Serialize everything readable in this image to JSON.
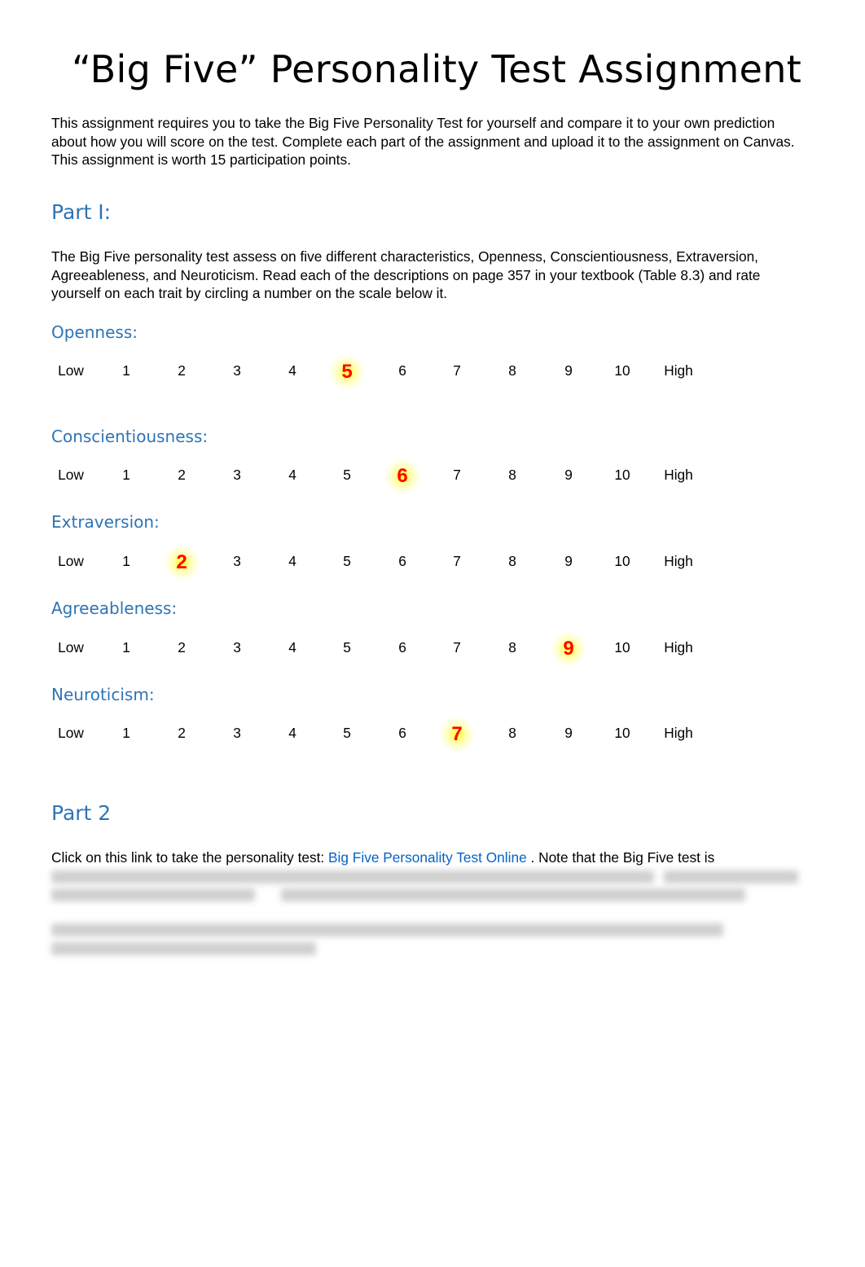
{
  "document": {
    "title": "“Big Five” Personality Test Assignment",
    "intro": "This assignment requires you to take the Big Five Personality Test for yourself and compare it to your own prediction about how you will score on the test.  Complete each part of the assignment and upload it to the assignment on Canvas.  This assignment is worth 15 participation points.",
    "part1": {
      "heading": "Part I:",
      "instructions": "The Big Five personality test assess on five different characteristics, Openness, Conscientiousness, Extraversion, Agreeableness, and Neuroticism.  Read each of the descriptions on page 357 in your textbook (Table 8.3) and rate yourself on each trait by circling a number on the scale below it.",
      "scale_low": "Low",
      "scale_high": "High",
      "scale_values": [
        "1",
        "2",
        "3",
        "4",
        "5",
        "6",
        "7",
        "8",
        "9",
        "10"
      ],
      "traits": [
        {
          "label": "Openness:",
          "selected": 5
        },
        {
          "label": "Conscientiousness:",
          "selected": 6
        },
        {
          "label": "Extraversion:",
          "selected": 2
        },
        {
          "label": "Agreeableness:",
          "selected": 9
        },
        {
          "label": "Neuroticism:",
          "selected": 7
        }
      ],
      "highlight_color": "#ffff00",
      "selected_color": "#ff0000"
    },
    "part2": {
      "heading": "Part 2",
      "text_before_link": "Click on this link to take the personality test:  ",
      "link_text": "Big Five Personality Test Online",
      "text_after_link": " .  Note that the Big Five test is"
    }
  }
}
